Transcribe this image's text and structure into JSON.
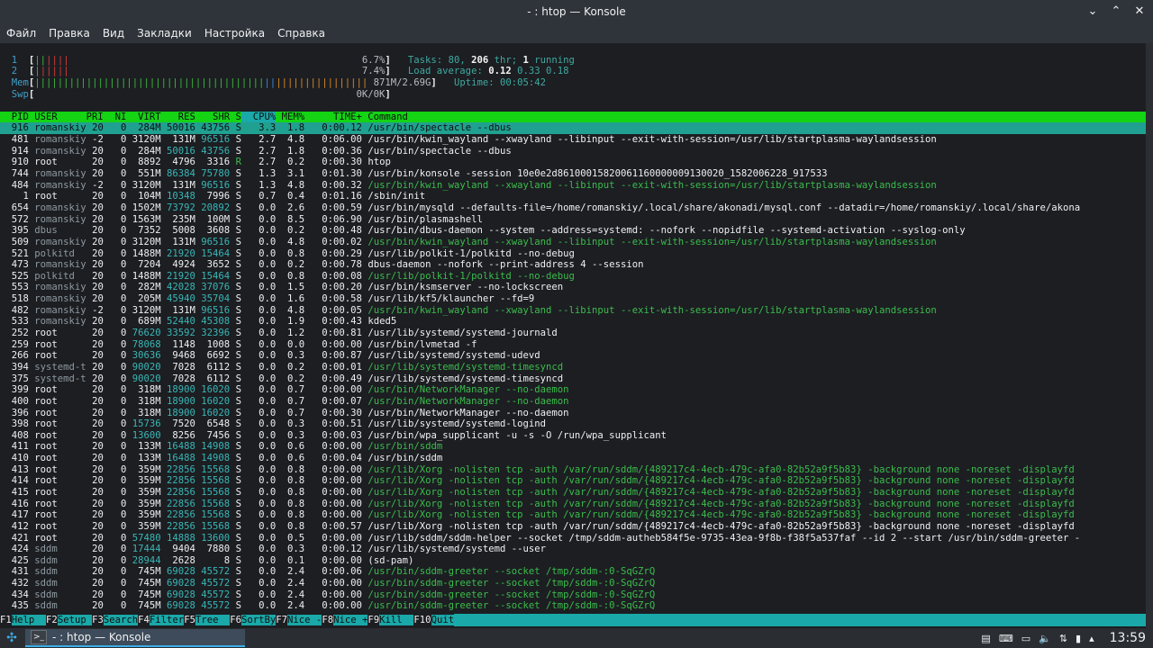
{
  "window": {
    "title": "- : htop — Konsole"
  },
  "menu": [
    "Файл",
    "Правка",
    "Вид",
    "Закладки",
    "Настройка",
    "Справка"
  ],
  "meters": {
    "cpu1": {
      "label": "1",
      "percent": "6.7%"
    },
    "cpu2": {
      "label": "2",
      "percent": "7.4%"
    },
    "mem": {
      "label": "Mem",
      "value": "871M/2.69G"
    },
    "swp": {
      "label": "Swp",
      "value": "0K/0K"
    },
    "tasks": {
      "prefix": "Tasks: ",
      "count": "80",
      "sep1": ", ",
      "threads": "206",
      "thr_label": " thr; ",
      "running": "1",
      "running_label": " running"
    },
    "load": {
      "prefix": "Load average: ",
      "one": "0.12",
      "five": "0.33",
      "fifteen": "0.18"
    },
    "uptime": {
      "prefix": "Uptime: ",
      "value": "00:05:42"
    }
  },
  "columns": [
    "PID",
    "USER",
    "PRI",
    "NI",
    "VIRT",
    "RES",
    "SHR",
    "S",
    "CPU%",
    "MEM%",
    "TIME+",
    "Command"
  ],
  "processes": [
    {
      "pid": "916",
      "user": "romanskiy",
      "pri": "20",
      "ni": "0",
      "virt": "284M",
      "res": "50016",
      "shr": "43756",
      "s": "S",
      "cpu": "3.3",
      "mem": "1.8",
      "time": "0:00.12",
      "cmd": "/usr/bin/spectacle --dbus",
      "sel": true
    },
    {
      "pid": "481",
      "user": "romanskiy",
      "pri": "-2",
      "ni": "0",
      "virt": "3120M",
      "res": "131M",
      "shr": "96516",
      "s": "S",
      "cpu": "2.7",
      "mem": "4.8",
      "time": "0:06.00",
      "cmd": "/usr/bin/kwin_wayland --xwayland --libinput --exit-with-session=/usr/lib/startplasma-waylandsession"
    },
    {
      "pid": "914",
      "user": "romanskiy",
      "pri": "20",
      "ni": "0",
      "virt": "284M",
      "res": "50016",
      "shr": "43756",
      "s": "S",
      "cpu": "2.7",
      "mem": "1.8",
      "time": "0:00.36",
      "cmd": "/usr/bin/spectacle --dbus"
    },
    {
      "pid": "910",
      "user": "root",
      "pri": "20",
      "ni": "0",
      "virt": "8892",
      "res": "4796",
      "shr": "3316",
      "s": "R",
      "cpu": "2.7",
      "mem": "0.2",
      "time": "0:00.30",
      "cmd": "htop"
    },
    {
      "pid": "744",
      "user": "romanskiy",
      "pri": "20",
      "ni": "0",
      "virt": "551M",
      "res": "86384",
      "shr": "75780",
      "s": "S",
      "cpu": "1.3",
      "mem": "3.1",
      "time": "0:01.30",
      "cmd": "/usr/bin/konsole -session 10e0e2d86100015820061160000009130020_1582006228_917533"
    },
    {
      "pid": "484",
      "user": "romanskiy",
      "pri": "-2",
      "ni": "0",
      "virt": "3120M",
      "res": "131M",
      "shr": "96516",
      "s": "S",
      "cpu": "1.3",
      "mem": "4.8",
      "time": "0:00.32",
      "cmd": "/usr/bin/kwin_wayland --xwayland --libinput --exit-with-session=/usr/lib/startplasma-waylandsession",
      "thread": true
    },
    {
      "pid": "1",
      "user": "root",
      "pri": "20",
      "ni": "0",
      "virt": "104M",
      "res": "10348",
      "shr": "7996",
      "s": "S",
      "cpu": "0.7",
      "mem": "0.4",
      "time": "0:01.16",
      "cmd": "/sbin/init"
    },
    {
      "pid": "654",
      "user": "romanskiy",
      "pri": "20",
      "ni": "0",
      "virt": "1502M",
      "res": "73792",
      "shr": "20892",
      "s": "S",
      "cpu": "0.0",
      "mem": "2.6",
      "time": "0:00.59",
      "cmd": "/usr/bin/mysqld --defaults-file=/home/romanskiy/.local/share/akonadi/mysql.conf --datadir=/home/romanskiy/.local/share/akona"
    },
    {
      "pid": "572",
      "user": "romanskiy",
      "pri": "20",
      "ni": "0",
      "virt": "1563M",
      "res": "235M",
      "shr": "100M",
      "s": "S",
      "cpu": "0.0",
      "mem": "8.5",
      "time": "0:06.90",
      "cmd": "/usr/bin/plasmashell"
    },
    {
      "pid": "395",
      "user": "dbus",
      "pri": "20",
      "ni": "0",
      "virt": "7352",
      "res": "5008",
      "shr": "3608",
      "s": "S",
      "cpu": "0.0",
      "mem": "0.2",
      "time": "0:00.48",
      "cmd": "/usr/bin/dbus-daemon --system --address=systemd: --nofork --nopidfile --systemd-activation --syslog-only"
    },
    {
      "pid": "509",
      "user": "romanskiy",
      "pri": "20",
      "ni": "0",
      "virt": "3120M",
      "res": "131M",
      "shr": "96516",
      "s": "S",
      "cpu": "0.0",
      "mem": "4.8",
      "time": "0:00.02",
      "cmd": "/usr/bin/kwin_wayland --xwayland --libinput --exit-with-session=/usr/lib/startplasma-waylandsession",
      "thread": true
    },
    {
      "pid": "521",
      "user": "polkitd",
      "pri": "20",
      "ni": "0",
      "virt": "1488M",
      "res": "21920",
      "shr": "15464",
      "s": "S",
      "cpu": "0.0",
      "mem": "0.8",
      "time": "0:00.29",
      "cmd": "/usr/lib/polkit-1/polkitd --no-debug"
    },
    {
      "pid": "473",
      "user": "romanskiy",
      "pri": "20",
      "ni": "0",
      "virt": "7204",
      "res": "4924",
      "shr": "3652",
      "s": "S",
      "cpu": "0.0",
      "mem": "0.2",
      "time": "0:00.78",
      "cmd": "dbus-daemon --nofork --print-address 4 --session"
    },
    {
      "pid": "525",
      "user": "polkitd",
      "pri": "20",
      "ni": "0",
      "virt": "1488M",
      "res": "21920",
      "shr": "15464",
      "s": "S",
      "cpu": "0.0",
      "mem": "0.8",
      "time": "0:00.08",
      "cmd": "/usr/lib/polkit-1/polkitd --no-debug",
      "thread": true
    },
    {
      "pid": "553",
      "user": "romanskiy",
      "pri": "20",
      "ni": "0",
      "virt": "282M",
      "res": "42028",
      "shr": "37076",
      "s": "S",
      "cpu": "0.0",
      "mem": "1.5",
      "time": "0:00.20",
      "cmd": "/usr/bin/ksmserver --no-lockscreen"
    },
    {
      "pid": "518",
      "user": "romanskiy",
      "pri": "20",
      "ni": "0",
      "virt": "205M",
      "res": "45940",
      "shr": "35704",
      "s": "S",
      "cpu": "0.0",
      "mem": "1.6",
      "time": "0:00.58",
      "cmd": "/usr/lib/kf5/klauncher --fd=9"
    },
    {
      "pid": "482",
      "user": "romanskiy",
      "pri": "-2",
      "ni": "0",
      "virt": "3120M",
      "res": "131M",
      "shr": "96516",
      "s": "S",
      "cpu": "0.0",
      "mem": "4.8",
      "time": "0:00.05",
      "cmd": "/usr/bin/kwin_wayland --xwayland --libinput --exit-with-session=/usr/lib/startplasma-waylandsession",
      "thread": true
    },
    {
      "pid": "533",
      "user": "romanskiy",
      "pri": "20",
      "ni": "0",
      "virt": "689M",
      "res": "52440",
      "shr": "45308",
      "s": "S",
      "cpu": "0.0",
      "mem": "1.9",
      "time": "0:00.43",
      "cmd": "kded5"
    },
    {
      "pid": "252",
      "user": "root",
      "pri": "20",
      "ni": "0",
      "virt": "76620",
      "res": "33592",
      "shr": "32396",
      "s": "S",
      "cpu": "0.0",
      "mem": "1.2",
      "time": "0:00.81",
      "cmd": "/usr/lib/systemd/systemd-journald"
    },
    {
      "pid": "259",
      "user": "root",
      "pri": "20",
      "ni": "0",
      "virt": "78068",
      "res": "1148",
      "shr": "1008",
      "s": "S",
      "cpu": "0.0",
      "mem": "0.0",
      "time": "0:00.00",
      "cmd": "/usr/bin/lvmetad -f"
    },
    {
      "pid": "266",
      "user": "root",
      "pri": "20",
      "ni": "0",
      "virt": "30636",
      "res": "9468",
      "shr": "6692",
      "s": "S",
      "cpu": "0.0",
      "mem": "0.3",
      "time": "0:00.87",
      "cmd": "/usr/lib/systemd/systemd-udevd"
    },
    {
      "pid": "394",
      "user": "systemd-t",
      "pri": "20",
      "ni": "0",
      "virt": "90020",
      "res": "7028",
      "shr": "6112",
      "s": "S",
      "cpu": "0.0",
      "mem": "0.2",
      "time": "0:00.01",
      "cmd": "/usr/lib/systemd/systemd-timesyncd",
      "thread": true
    },
    {
      "pid": "375",
      "user": "systemd-t",
      "pri": "20",
      "ni": "0",
      "virt": "90020",
      "res": "7028",
      "shr": "6112",
      "s": "S",
      "cpu": "0.0",
      "mem": "0.2",
      "time": "0:00.49",
      "cmd": "/usr/lib/systemd/systemd-timesyncd"
    },
    {
      "pid": "399",
      "user": "root",
      "pri": "20",
      "ni": "0",
      "virt": "318M",
      "res": "18900",
      "shr": "16020",
      "s": "S",
      "cpu": "0.0",
      "mem": "0.7",
      "time": "0:00.00",
      "cmd": "/usr/bin/NetworkManager --no-daemon",
      "thread": true
    },
    {
      "pid": "400",
      "user": "root",
      "pri": "20",
      "ni": "0",
      "virt": "318M",
      "res": "18900",
      "shr": "16020",
      "s": "S",
      "cpu": "0.0",
      "mem": "0.7",
      "time": "0:00.07",
      "cmd": "/usr/bin/NetworkManager --no-daemon",
      "thread": true
    },
    {
      "pid": "396",
      "user": "root",
      "pri": "20",
      "ni": "0",
      "virt": "318M",
      "res": "18900",
      "shr": "16020",
      "s": "S",
      "cpu": "0.0",
      "mem": "0.7",
      "time": "0:00.30",
      "cmd": "/usr/bin/NetworkManager --no-daemon"
    },
    {
      "pid": "398",
      "user": "root",
      "pri": "20",
      "ni": "0",
      "virt": "15736",
      "res": "7520",
      "shr": "6548",
      "s": "S",
      "cpu": "0.0",
      "mem": "0.3",
      "time": "0:00.51",
      "cmd": "/usr/lib/systemd/systemd-logind"
    },
    {
      "pid": "408",
      "user": "root",
      "pri": "20",
      "ni": "0",
      "virt": "13600",
      "res": "8256",
      "shr": "7456",
      "s": "S",
      "cpu": "0.0",
      "mem": "0.3",
      "time": "0:00.03",
      "cmd": "/usr/bin/wpa_supplicant -u -s -O /run/wpa_supplicant"
    },
    {
      "pid": "411",
      "user": "root",
      "pri": "20",
      "ni": "0",
      "virt": "133M",
      "res": "16488",
      "shr": "14908",
      "s": "S",
      "cpu": "0.0",
      "mem": "0.6",
      "time": "0:00.00",
      "cmd": "/usr/bin/sddm",
      "thread": true
    },
    {
      "pid": "410",
      "user": "root",
      "pri": "20",
      "ni": "0",
      "virt": "133M",
      "res": "16488",
      "shr": "14908",
      "s": "S",
      "cpu": "0.0",
      "mem": "0.6",
      "time": "0:00.04",
      "cmd": "/usr/bin/sddm"
    },
    {
      "pid": "413",
      "user": "root",
      "pri": "20",
      "ni": "0",
      "virt": "359M",
      "res": "22856",
      "shr": "15568",
      "s": "S",
      "cpu": "0.0",
      "mem": "0.8",
      "time": "0:00.00",
      "cmd": "/usr/lib/Xorg -nolisten tcp -auth /var/run/sddm/{489217c4-4ecb-479c-afa0-82b52a9f5b83} -background none -noreset -displayfd",
      "thread": true
    },
    {
      "pid": "414",
      "user": "root",
      "pri": "20",
      "ni": "0",
      "virt": "359M",
      "res": "22856",
      "shr": "15568",
      "s": "S",
      "cpu": "0.0",
      "mem": "0.8",
      "time": "0:00.00",
      "cmd": "/usr/lib/Xorg -nolisten tcp -auth /var/run/sddm/{489217c4-4ecb-479c-afa0-82b52a9f5b83} -background none -noreset -displayfd",
      "thread": true
    },
    {
      "pid": "415",
      "user": "root",
      "pri": "20",
      "ni": "0",
      "virt": "359M",
      "res": "22856",
      "shr": "15568",
      "s": "S",
      "cpu": "0.0",
      "mem": "0.8",
      "time": "0:00.00",
      "cmd": "/usr/lib/Xorg -nolisten tcp -auth /var/run/sddm/{489217c4-4ecb-479c-afa0-82b52a9f5b83} -background none -noreset -displayfd",
      "thread": true
    },
    {
      "pid": "416",
      "user": "root",
      "pri": "20",
      "ni": "0",
      "virt": "359M",
      "res": "22856",
      "shr": "15568",
      "s": "S",
      "cpu": "0.0",
      "mem": "0.8",
      "time": "0:00.00",
      "cmd": "/usr/lib/Xorg -nolisten tcp -auth /var/run/sddm/{489217c4-4ecb-479c-afa0-82b52a9f5b83} -background none -noreset -displayfd",
      "thread": true
    },
    {
      "pid": "417",
      "user": "root",
      "pri": "20",
      "ni": "0",
      "virt": "359M",
      "res": "22856",
      "shr": "15568",
      "s": "S",
      "cpu": "0.0",
      "mem": "0.8",
      "time": "0:00.00",
      "cmd": "/usr/lib/Xorg -nolisten tcp -auth /var/run/sddm/{489217c4-4ecb-479c-afa0-82b52a9f5b83} -background none -noreset -displayfd",
      "thread": true
    },
    {
      "pid": "412",
      "user": "root",
      "pri": "20",
      "ni": "0",
      "virt": "359M",
      "res": "22856",
      "shr": "15568",
      "s": "S",
      "cpu": "0.0",
      "mem": "0.8",
      "time": "0:00.57",
      "cmd": "/usr/lib/Xorg -nolisten tcp -auth /var/run/sddm/{489217c4-4ecb-479c-afa0-82b52a9f5b83} -background none -noreset -displayfd"
    },
    {
      "pid": "421",
      "user": "root",
      "pri": "20",
      "ni": "0",
      "virt": "57480",
      "res": "14888",
      "shr": "13600",
      "s": "S",
      "cpu": "0.0",
      "mem": "0.5",
      "time": "0:00.00",
      "cmd": "/usr/lib/sddm/sddm-helper --socket /tmp/sddm-autheb584f5e-9735-43ea-9f8b-f38f5a537faf --id 2 --start /usr/bin/sddm-greeter -"
    },
    {
      "pid": "424",
      "user": "sddm",
      "pri": "20",
      "ni": "0",
      "virt": "17444",
      "res": "9404",
      "shr": "7880",
      "s": "S",
      "cpu": "0.0",
      "mem": "0.3",
      "time": "0:00.12",
      "cmd": "/usr/lib/systemd/systemd --user"
    },
    {
      "pid": "425",
      "user": "sddm",
      "pri": "20",
      "ni": "0",
      "virt": "28944",
      "res": "2628",
      "shr": "8",
      "s": "S",
      "cpu": "0.0",
      "mem": "0.1",
      "time": "0:00.00",
      "cmd": "(sd-pam)"
    },
    {
      "pid": "431",
      "user": "sddm",
      "pri": "20",
      "ni": "0",
      "virt": "745M",
      "res": "69028",
      "shr": "45572",
      "s": "S",
      "cpu": "0.0",
      "mem": "2.4",
      "time": "0:00.06",
      "cmd": "/usr/bin/sddm-greeter --socket /tmp/sddm-:0-SqGZrQ",
      "thread": true
    },
    {
      "pid": "432",
      "user": "sddm",
      "pri": "20",
      "ni": "0",
      "virt": "745M",
      "res": "69028",
      "shr": "45572",
      "s": "S",
      "cpu": "0.0",
      "mem": "2.4",
      "time": "0:00.00",
      "cmd": "/usr/bin/sddm-greeter --socket /tmp/sddm-:0-SqGZrQ",
      "thread": true
    },
    {
      "pid": "434",
      "user": "sddm",
      "pri": "20",
      "ni": "0",
      "virt": "745M",
      "res": "69028",
      "shr": "45572",
      "s": "S",
      "cpu": "0.0",
      "mem": "2.4",
      "time": "0:00.00",
      "cmd": "/usr/bin/sddm-greeter --socket /tmp/sddm-:0-SqGZrQ",
      "thread": true
    },
    {
      "pid": "435",
      "user": "sddm",
      "pri": "20",
      "ni": "0",
      "virt": "745M",
      "res": "69028",
      "shr": "45572",
      "s": "S",
      "cpu": "0.0",
      "mem": "2.4",
      "time": "0:00.00",
      "cmd": "/usr/bin/sddm-greeter --socket /tmp/sddm-:0-SqGZrQ",
      "thread": true
    }
  ],
  "fkeys": [
    {
      "key": "F1",
      "label": "Help  "
    },
    {
      "key": "F2",
      "label": "Setup "
    },
    {
      "key": "F3",
      "label": "Search"
    },
    {
      "key": "F4",
      "label": "Filter"
    },
    {
      "key": "F5",
      "label": "Tree  "
    },
    {
      "key": "F6",
      "label": "SortBy"
    },
    {
      "key": "F7",
      "label": "Nice -"
    },
    {
      "key": "F8",
      "label": "Nice +"
    },
    {
      "key": "F9",
      "label": "Kill  "
    },
    {
      "key": "F10",
      "label": "Quit"
    }
  ],
  "taskbar": {
    "task_label": "- : htop — Konsole",
    "clock": "13:59"
  },
  "colors": {
    "header_bg": "#14d414",
    "selected_bg": "#20a090",
    "fkey_label_bg": "#1aa8a8"
  }
}
